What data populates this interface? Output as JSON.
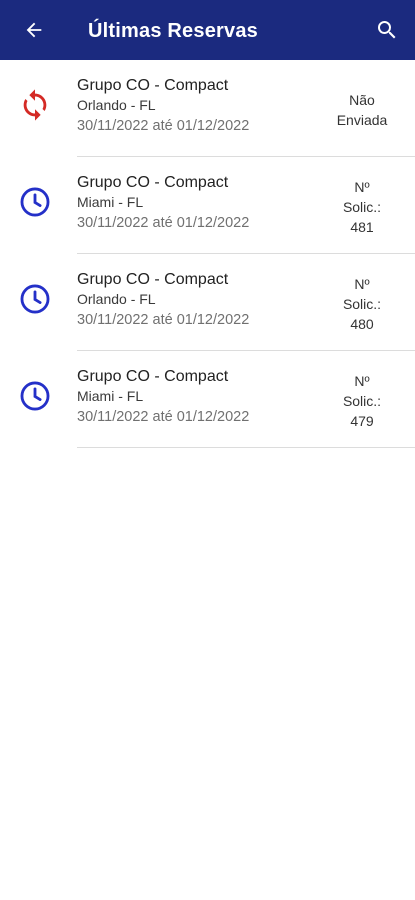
{
  "app_bar": {
    "title": "Últimas Reservas",
    "back_icon": "arrow-left-icon",
    "search_icon": "search-icon",
    "background_color": "#1b2a7f"
  },
  "reservations": [
    {
      "group": "Grupo CO - Compact",
      "location": "Orlando - FL",
      "dates": "30/11/2022 até 01/12/2022",
      "status_icon": "sync-icon",
      "status_color": "#d42a25",
      "status_lines": [
        "Não",
        "Enviada"
      ]
    },
    {
      "group": "Grupo CO - Compact",
      "location": "Miami - FL",
      "dates": "30/11/2022 até 01/12/2022",
      "status_icon": "clock-icon",
      "status_color": "#2430c8",
      "status_lines": [
        "Nº",
        "Solic.:",
        "481"
      ]
    },
    {
      "group": "Grupo CO - Compact",
      "location": "Orlando - FL",
      "dates": "30/11/2022 até 01/12/2022",
      "status_icon": "clock-icon",
      "status_color": "#2430c8",
      "status_lines": [
        "Nº",
        "Solic.:",
        "480"
      ]
    },
    {
      "group": "Grupo CO - Compact",
      "location": "Miami - FL",
      "dates": "30/11/2022 até 01/12/2022",
      "status_icon": "clock-icon",
      "status_color": "#2430c8",
      "status_lines": [
        "Nº",
        "Solic.:",
        "479"
      ]
    }
  ]
}
